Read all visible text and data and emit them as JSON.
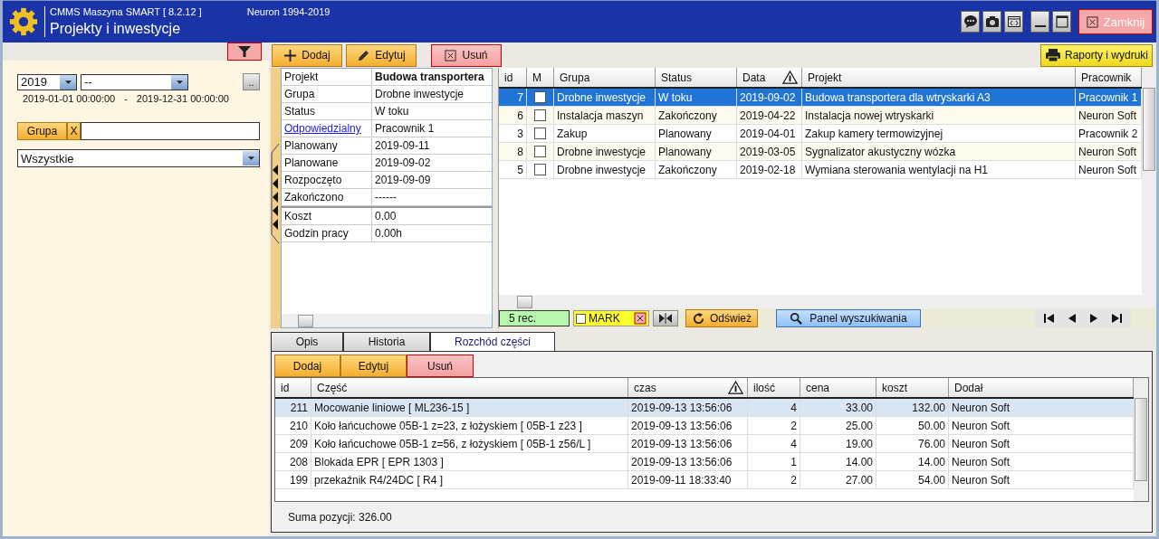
{
  "window": {
    "app_name": "CMMS Maszyna SMART  [ 8.2.12 ]",
    "copyright": "Neuron 1994-2019",
    "title": "Projekty i inwestycje",
    "close_label": "Zamknij"
  },
  "filters": {
    "year": "2019",
    "period": "--",
    "more_label": "..",
    "date_from": "2019-01-01  00:00:00",
    "date_sep": "-",
    "date_to": "2019-12-31  00:00:00",
    "group_label": "Grupa",
    "group_clear": "X",
    "group_select": "Wszystkie"
  },
  "toolbar": {
    "add": "Dodaj",
    "edit": "Edytuj",
    "delete": "Usuń",
    "reports": "Raporty i wydruki"
  },
  "details": [
    {
      "label": "Projekt",
      "value": "Budowa transportera",
      "kind": "bold"
    },
    {
      "label": "Grupa",
      "value": "Drobne inwestycje",
      "kind": "plain"
    },
    {
      "label": "Status",
      "value": "W toku",
      "kind": "plain"
    },
    {
      "label": "Odpowiedzialny",
      "value": "Pracownik 1",
      "kind": "link"
    },
    {
      "label": "Planowany",
      "value": "2019-09-11",
      "kind": "plain"
    },
    {
      "label": "Planowane",
      "value": "2019-09-02",
      "kind": "plain"
    },
    {
      "label": "Rozpoczęto",
      "value": "2019-09-09",
      "kind": "plain"
    },
    {
      "label": "Zakończono",
      "value": "------",
      "kind": "plain"
    }
  ],
  "totals": [
    {
      "label": "Koszt",
      "value": "0.00"
    },
    {
      "label": "Godzin pracy",
      "value": "0.00h"
    }
  ],
  "projects": {
    "columns": [
      "id",
      "M",
      "Grupa",
      "Status",
      "Data",
      "Projekt",
      "Pracownik"
    ],
    "rows": [
      {
        "id": "7",
        "checked": false,
        "group": "Drobne inwestycje",
        "status": "W toku",
        "date": "2019-09-02",
        "project": "Budowa transportera dla wtryskarki A3",
        "worker": "Pracownik 1",
        "selected": true
      },
      {
        "id": "6",
        "checked": false,
        "group": "Instalacja maszyn",
        "status": "Zakończony",
        "date": "2019-04-22",
        "project": "Instalacja nowej wtryskarki",
        "worker": "Neuron Soft",
        "selected": false
      },
      {
        "id": "3",
        "checked": false,
        "group": "Zakup",
        "status": "Planowany",
        "date": "2019-04-01",
        "project": "Zakup kamery termowizyjnej",
        "worker": "Pracownik 2",
        "selected": false
      },
      {
        "id": "8",
        "checked": false,
        "group": "Drobne inwestycje",
        "status": "Planowany",
        "date": "2019-03-05",
        "project": "Sygnalizator akustyczny wózka",
        "worker": "Neuron Soft",
        "selected": false
      },
      {
        "id": "5",
        "checked": false,
        "group": "Drobne inwestycje",
        "status": "Zakończony",
        "date": "2019-02-18",
        "project": "Wymiana sterowania wentylacji na H1",
        "worker": "Neuron Soft",
        "selected": false
      }
    ]
  },
  "status_bar": {
    "count": "5 rec.",
    "mark_label": "MARK",
    "mark_checked": false,
    "refresh": "Odśwież",
    "search_panel": "Panel wyszukiwania"
  },
  "tabs": [
    {
      "label": "Opis",
      "selected": false
    },
    {
      "label": "Historia",
      "selected": false
    },
    {
      "label": "Rozchód części",
      "selected": true
    }
  ],
  "parts_toolbar": {
    "add": "Dodaj",
    "edit": "Edytuj",
    "delete": "Usuń"
  },
  "parts": {
    "columns": [
      "id",
      "Część",
      "czas",
      "ilość",
      "cena",
      "koszt",
      "Dodał"
    ],
    "rows": [
      {
        "id": "211",
        "part": "Mocowanie liniowe [ ML236-15 ]",
        "time": "2019-09-13  13:56:06",
        "qty": "4",
        "price": "33.00",
        "cost": "132.00",
        "added_by": "Neuron Soft",
        "selected": true
      },
      {
        "id": "210",
        "part": "Koło łańcuchowe 05B-1 z=23, z łożyskiem [ 05B-1 z23 ]",
        "time": "2019-09-13  13:56:06",
        "qty": "2",
        "price": "25.00",
        "cost": "50.00",
        "added_by": "Neuron Soft",
        "selected": false
      },
      {
        "id": "209",
        "part": "Koło łańcuchowe 05B-1 z=56, z łożyskiem [ 05B-1 z56/L ]",
        "time": "2019-09-13  13:56:06",
        "qty": "4",
        "price": "19.00",
        "cost": "76.00",
        "added_by": "Neuron Soft",
        "selected": false
      },
      {
        "id": "208",
        "part": "Blokada EPR [ EPR 1303 ]",
        "time": "2019-09-13  13:56:06",
        "qty": "1",
        "price": "14.00",
        "cost": "14.00",
        "added_by": "Neuron Soft",
        "selected": false
      },
      {
        "id": "199",
        "part": "przekaźnik R4/24DC [ R4 ]",
        "time": "2019-09-11  18:33:40",
        "qty": "2",
        "price": "27.00",
        "cost": "54.00",
        "added_by": "Neuron Soft",
        "selected": false
      }
    ]
  },
  "sum_label": "Suma pozycji:  326.00"
}
